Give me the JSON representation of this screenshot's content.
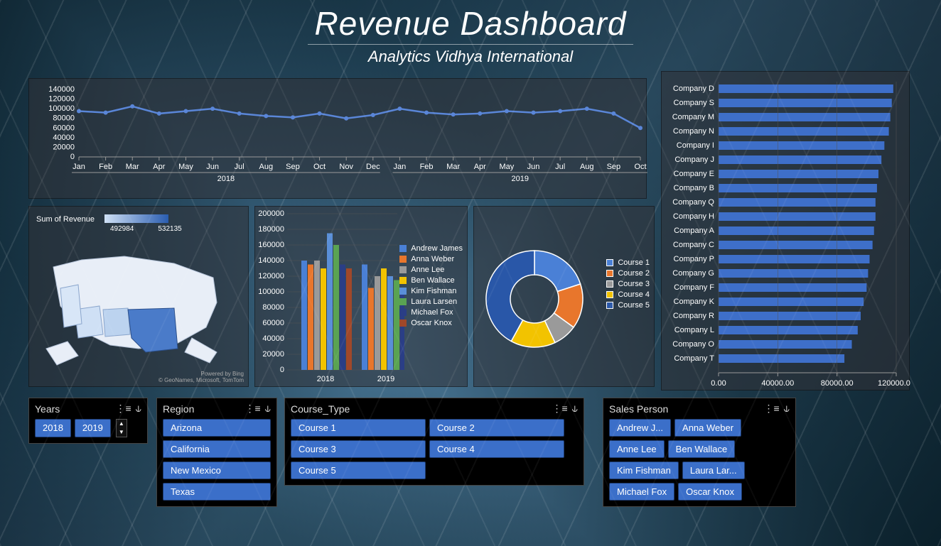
{
  "header": {
    "title": "Revenue Dashboard",
    "subtitle": "Analytics Vidhya International"
  },
  "line_chart": {
    "y_ticks": [
      0,
      20000,
      40000,
      60000,
      80000,
      100000,
      120000,
      140000
    ],
    "years": [
      "2018",
      "2019"
    ],
    "months": [
      "Jan",
      "Feb",
      "Mar",
      "Apr",
      "May",
      "Jun",
      "Jul",
      "Aug",
      "Sep",
      "Oct",
      "Nov",
      "Dec",
      "Jan",
      "Feb",
      "Mar",
      "Apr",
      "May",
      "Jun",
      "Jul",
      "Aug",
      "Sep",
      "Oct"
    ]
  },
  "map_panel": {
    "legend_title": "Sum of Revenue",
    "legend_min": "492984",
    "legend_max": "532135",
    "credit1": "Powered by Bing",
    "credit2": "© GeoNames, Microsoft, TomTom"
  },
  "bar_chart": {
    "y_ticks": [
      0,
      20000,
      40000,
      60000,
      80000,
      100000,
      120000,
      140000,
      160000,
      180000,
      200000
    ]
  },
  "people_legend": [
    {
      "name": "Andrew James",
      "color": "#4a80d6"
    },
    {
      "name": "Anna Weber",
      "color": "#e8762c"
    },
    {
      "name": "Anne Lee",
      "color": "#9a9a9a"
    },
    {
      "name": "Ben Wallace",
      "color": "#f2c300"
    },
    {
      "name": "Kim Fishman",
      "color": "#5a8fd8"
    },
    {
      "name": "Laura Larsen",
      "color": "#5aa352"
    },
    {
      "name": "Michael Fox",
      "color": "#2a3e86"
    },
    {
      "name": "Oscar Knox",
      "color": "#a0482a"
    }
  ],
  "course_legend": [
    {
      "name": "Course 1",
      "color": "#4a80d6"
    },
    {
      "name": "Course 2",
      "color": "#e8762c"
    },
    {
      "name": "Course 3",
      "color": "#9a9a9a"
    },
    {
      "name": "Course 4",
      "color": "#f2c300"
    },
    {
      "name": "Course 5",
      "color": "#2957a8"
    }
  ],
  "company_labels": [
    "Company D",
    "Company S",
    "Company M",
    "Company N",
    "Company I",
    "Company J",
    "Company E",
    "Company B",
    "Company Q",
    "Company H",
    "Company A",
    "Company C",
    "Company P",
    "Company G",
    "Company F",
    "Company K",
    "Company R",
    "Company L",
    "Company O",
    "Company T"
  ],
  "company_xticks": [
    "0.00",
    "40000.00",
    "80000.00",
    "120000.00"
  ],
  "slicers": {
    "years": {
      "title": "Years",
      "items": [
        "2018",
        "2019"
      ]
    },
    "region": {
      "title": "Region",
      "items": [
        "Arizona",
        "California",
        "New Mexico",
        "Texas"
      ]
    },
    "course": {
      "title": "Course_Type",
      "items": [
        "Course 1",
        "Course 2",
        "Course 3",
        "Course 4",
        "Course 5"
      ]
    },
    "sales": {
      "title": "Sales Person",
      "items": [
        "Andrew J...",
        "Anna Weber",
        "Anne Lee",
        "Ben Wallace",
        "Kim Fishman",
        "Laura Lar...",
        "Michael Fox",
        "Oscar Knox"
      ]
    }
  },
  "chart_data": [
    {
      "type": "line",
      "title": "",
      "x": [
        "2018-Jan",
        "2018-Feb",
        "2018-Mar",
        "2018-Apr",
        "2018-May",
        "2018-Jun",
        "2018-Jul",
        "2018-Aug",
        "2018-Sep",
        "2018-Oct",
        "2018-Nov",
        "2018-Dec",
        "2019-Jan",
        "2019-Feb",
        "2019-Mar",
        "2019-Apr",
        "2019-May",
        "2019-Jun",
        "2019-Jul",
        "2019-Aug",
        "2019-Sep",
        "2019-Oct"
      ],
      "series": [
        {
          "name": "Revenue",
          "values": [
            95000,
            92000,
            105000,
            90000,
            95000,
            100000,
            90000,
            85000,
            82000,
            90000,
            80000,
            87000,
            100000,
            92000,
            88000,
            90000,
            95000,
            92000,
            95000,
            100000,
            90000,
            60000
          ]
        }
      ],
      "ylim": [
        0,
        140000
      ],
      "ylabel": "",
      "xlabel": ""
    },
    {
      "type": "bar",
      "title": "",
      "categories": [
        "2018",
        "2019"
      ],
      "series": [
        {
          "name": "Andrew James",
          "color": "#4a80d6",
          "values": [
            140000,
            135000
          ]
        },
        {
          "name": "Anna Weber",
          "color": "#e8762c",
          "values": [
            135000,
            105000
          ]
        },
        {
          "name": "Anne Lee",
          "color": "#9a9a9a",
          "values": [
            140000,
            120000
          ]
        },
        {
          "name": "Ben Wallace",
          "color": "#f2c300",
          "values": [
            130000,
            130000
          ]
        },
        {
          "name": "Kim Fishman",
          "color": "#5a8fd8",
          "values": [
            175000,
            120000
          ]
        },
        {
          "name": "Laura Larsen",
          "color": "#5aa352",
          "values": [
            160000,
            115000
          ]
        },
        {
          "name": "Michael Fox",
          "color": "#2a3e86",
          "values": [
            135000,
            100000
          ]
        },
        {
          "name": "Oscar Knox",
          "color": "#a0482a",
          "values": [
            130000,
            95000
          ]
        }
      ],
      "ylim": [
        0,
        200000
      ]
    },
    {
      "type": "pie",
      "title": "",
      "series": [
        {
          "name": "Courses",
          "slices": [
            {
              "name": "Course 1",
              "value": 20,
              "color": "#4a80d6"
            },
            {
              "name": "Course 2",
              "value": 15,
              "color": "#e8762c"
            },
            {
              "name": "Course 3",
              "value": 8,
              "color": "#9a9a9a"
            },
            {
              "name": "Course 4",
              "value": 15,
              "color": "#f2c300"
            },
            {
              "name": "Course 5",
              "value": 42,
              "color": "#2957a8"
            }
          ]
        }
      ]
    },
    {
      "type": "bar",
      "orientation": "horizontal",
      "categories": [
        "Company D",
        "Company S",
        "Company M",
        "Company N",
        "Company I",
        "Company J",
        "Company E",
        "Company B",
        "Company Q",
        "Company H",
        "Company A",
        "Company C",
        "Company P",
        "Company G",
        "Company F",
        "Company K",
        "Company R",
        "Company L",
        "Company O",
        "Company T"
      ],
      "values": [
        118000,
        117000,
        116000,
        115000,
        112000,
        110000,
        108000,
        107000,
        106000,
        106000,
        105000,
        104000,
        102000,
        101000,
        100000,
        98000,
        96000,
        94000,
        90000,
        85000
      ],
      "xlim": [
        0,
        120000
      ]
    },
    {
      "type": "heatmap",
      "title": "Sum of Revenue by State",
      "categories": [
        "Arizona",
        "California",
        "New Mexico",
        "Texas"
      ],
      "values": [
        500000,
        515000,
        495000,
        532000
      ],
      "range": [
        492984,
        532135
      ]
    }
  ]
}
